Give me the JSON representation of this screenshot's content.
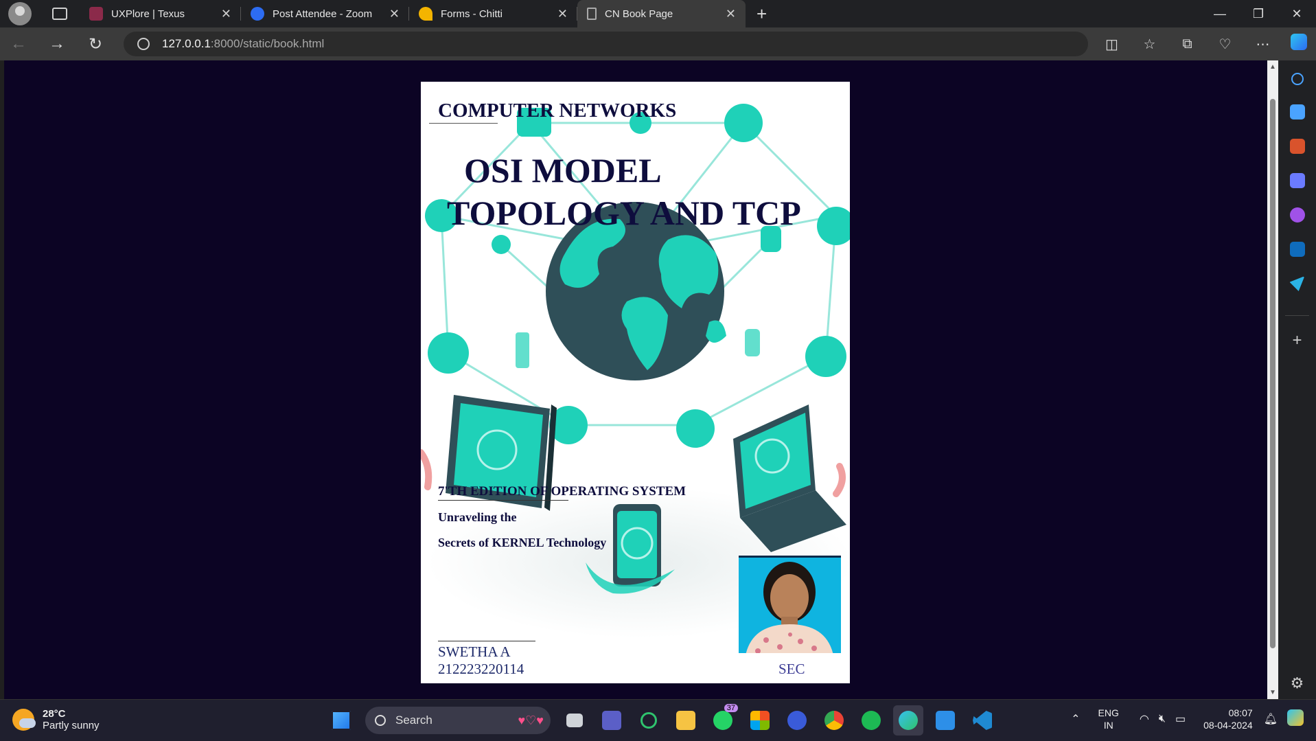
{
  "browser": {
    "tabs": [
      {
        "label": "UXPlore | Texus",
        "icon": "uxplore-icon",
        "color": "#8b2a4a"
      },
      {
        "label": "Post Attendee - Zoom",
        "icon": "zoom-icon",
        "color": "#2d6cf2"
      },
      {
        "label": "Forms - Chitti",
        "icon": "forms-icon",
        "color": "#f4b400"
      },
      {
        "label": "CN Book Page",
        "icon": "page-icon",
        "color": "#aaaaaa"
      }
    ],
    "url_host": "127.0.0.1",
    "url_path": ":8000/static/book.html"
  },
  "book": {
    "subject": "COMPUTER NETWORKS",
    "title_line1": "OSI MODEL",
    "title_line2": "TOPOLOGY AND TCP",
    "edition": "7'TH EDITION OF OPERATING SYSTEM",
    "subtitle_line1": "Unraveling the",
    "subtitle_line2": "Secrets of KERNEL Technology",
    "author": "SWETHA A",
    "roll_number": "212223220114",
    "college": "SEC",
    "accent_color": "#1fd1b8",
    "title_color": "#0e0d3d"
  },
  "taskbar": {
    "temperature": "28°C",
    "condition": "Partly sunny",
    "search_label": "Search",
    "whatsapp_badge": "37",
    "lang_line1": "ENG",
    "lang_line2": "IN",
    "time": "08:07",
    "date": "08-04-2024"
  }
}
